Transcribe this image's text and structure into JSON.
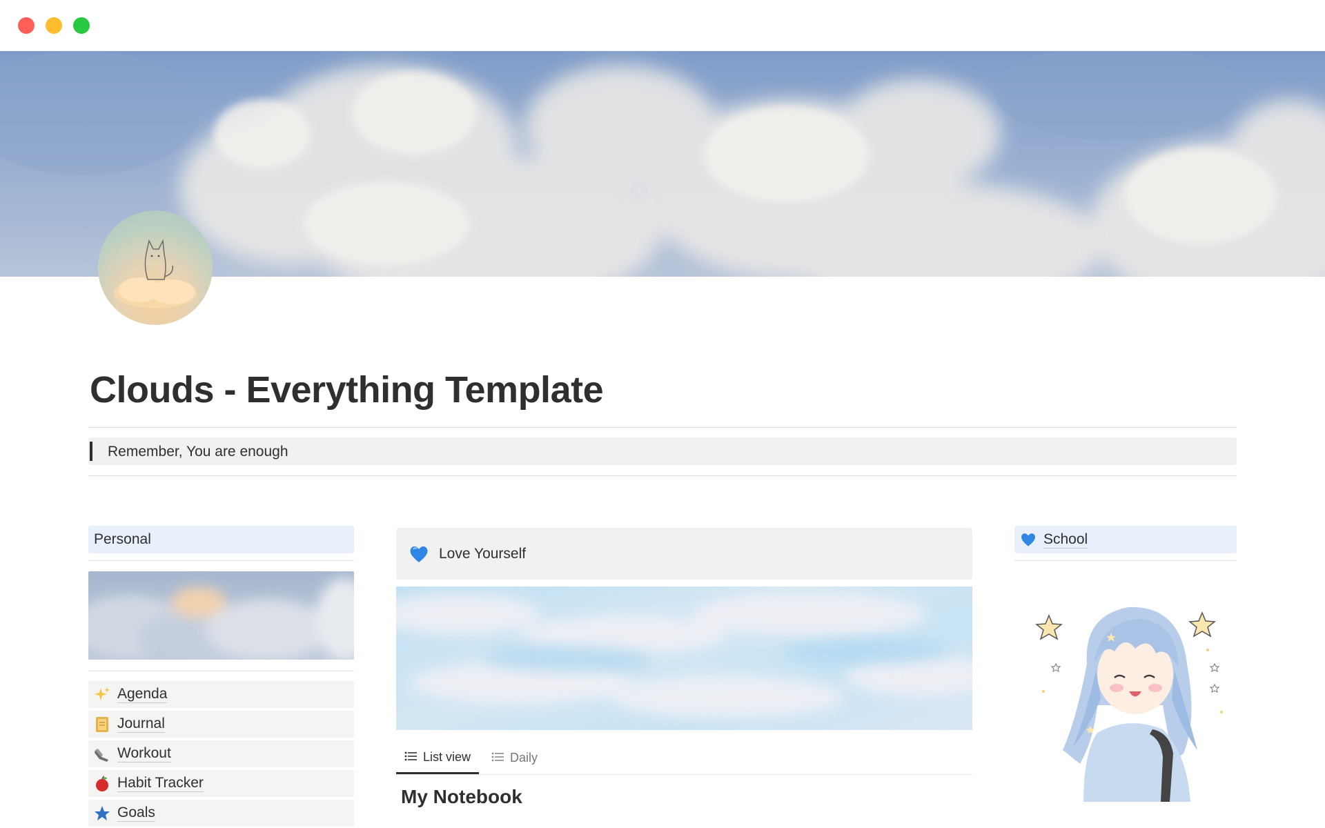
{
  "window": {
    "controls": [
      "close",
      "minimize",
      "maximize"
    ],
    "colors": {
      "close": "#ff5f57",
      "minimize": "#febc2e",
      "maximize": "#28c840"
    }
  },
  "page": {
    "title": "Clouds - Everything Template",
    "quote": "Remember, You are enough"
  },
  "personal": {
    "header": "Personal",
    "items": [
      {
        "icon": "sparkles-icon",
        "label": "Agenda"
      },
      {
        "icon": "notebook-icon",
        "label": "Journal"
      },
      {
        "icon": "sneaker-icon",
        "label": "Workout"
      },
      {
        "icon": "apple-icon",
        "label": "Habit Tracker"
      },
      {
        "icon": "star-icon",
        "label": "Goals"
      }
    ]
  },
  "main": {
    "callout_icon": "blue-heart-icon",
    "callout": "Love Yourself",
    "tabs": [
      {
        "icon": "list-icon",
        "label": "List view",
        "active": true
      },
      {
        "icon": "list-icon",
        "label": "Daily",
        "active": false
      }
    ],
    "database_title": "My Notebook"
  },
  "school": {
    "icon": "blue-heart-icon",
    "header": "School"
  },
  "colors": {
    "accent_header_bg": "#e7f0fb",
    "callout_bg": "#f1f1ef",
    "text": "#2f2f2f"
  }
}
